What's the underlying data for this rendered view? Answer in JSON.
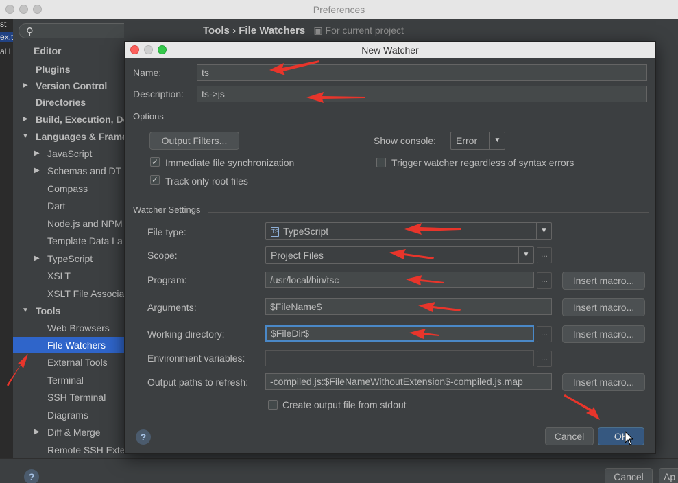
{
  "preferences": {
    "title": "Preferences",
    "search_placeholder": "",
    "breadcrumb_root": "Tools",
    "breadcrumb_sep": "›",
    "breadcrumb_leaf": "File Watchers",
    "breadcrumb_scope": "For current project",
    "left_strip": [
      "st",
      "ex.t",
      "al Li"
    ],
    "sidebar": {
      "editor": "Editor",
      "plugins": "Plugins",
      "version_control": "Version Control",
      "directories": "Directories",
      "build": "Build, Execution, De",
      "languages": "Languages & Frame",
      "javascript": "JavaScript",
      "schemas": "Schemas and DT",
      "compass": "Compass",
      "dart": "Dart",
      "nodejs": "Node.js and NPM",
      "template_data": "Template Data La",
      "typescript": "TypeScript",
      "xslt": "XSLT",
      "xslt_assoc": "XSLT File Associa",
      "tools": "Tools",
      "web_browsers": "Web Browsers",
      "file_watchers": "File Watchers",
      "external_tools": "External Tools",
      "terminal": "Terminal",
      "ssh_terminal": "SSH Terminal",
      "diagrams": "Diagrams",
      "diff_merge": "Diff & Merge",
      "remote_ssh": "Remote SSH Exte"
    },
    "bottom": {
      "help": "?",
      "cancel": "Cancel",
      "apply": "Ap"
    }
  },
  "dialog": {
    "title": "New Watcher",
    "name_label": "Name:",
    "name_value": "ts",
    "description_label": "Description:",
    "description_value": "ts->js",
    "options_header": "Options",
    "output_filters": "Output Filters...",
    "show_console_label": "Show console:",
    "show_console_value": "Error",
    "immediate_sync": "Immediate file synchronization",
    "immediate_sync_checked": true,
    "trigger_watcher": "Trigger watcher regardless of syntax errors",
    "trigger_watcher_checked": false,
    "track_root": "Track only root files",
    "track_root_checked": true,
    "watcher_settings_header": "Watcher Settings",
    "file_type_label": "File type:",
    "file_type_value": "TypeScript",
    "file_type_icon": "TS",
    "scope_label": "Scope:",
    "scope_value": "Project Files",
    "program_label": "Program:",
    "program_value": "/usr/local/bin/tsc",
    "arguments_label": "Arguments:",
    "arguments_value": "$FileName$",
    "working_dir_label": "Working directory:",
    "working_dir_value": "$FileDir$",
    "env_vars_label": "Environment variables:",
    "env_vars_value": "",
    "output_paths_label": "Output paths to refresh:",
    "output_paths_value": "-compiled.js:$FileNameWithoutExtension$-compiled.js.map",
    "insert_macro": "Insert macro...",
    "ellipsis": "...",
    "create_output": "Create output file from stdout",
    "create_output_checked": false,
    "help": "?",
    "cancel": "Cancel",
    "ok": "OK"
  },
  "colors": {
    "selection": "#2f65ca",
    "annotation_arrow": "#e8352b",
    "primary_button": "#365880"
  }
}
